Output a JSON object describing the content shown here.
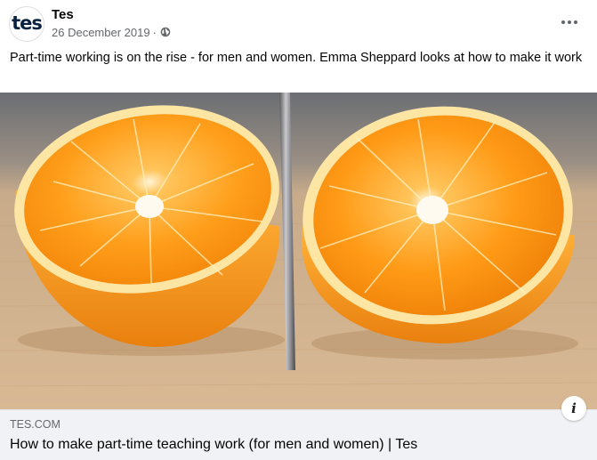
{
  "post": {
    "page_name": "Tes",
    "avatar_text": "tes",
    "date": "26 December 2019",
    "separator": "·",
    "privacy_icon": "globe-icon",
    "more_icon": "more-options-icon",
    "caption": "Part-time working is on the rise - for men and women. Emma Sheppard looks at how to make it work"
  },
  "link_preview": {
    "image_subject": "oranges-cut-by-knife-image",
    "domain": "TES.COM",
    "title": "How to make part-time teaching work (for men and women) | Tes",
    "info_icon": "info-icon",
    "info_glyph": "i"
  },
  "colors": {
    "text_primary": "#050505",
    "text_secondary": "#65676b",
    "footer_background": "#f0f2f5",
    "avatar_brand": "#0a2240",
    "orange_peel": "#f39a1d",
    "orange_flesh": "#ffa31a",
    "cutting_board": "#d6b48f"
  }
}
